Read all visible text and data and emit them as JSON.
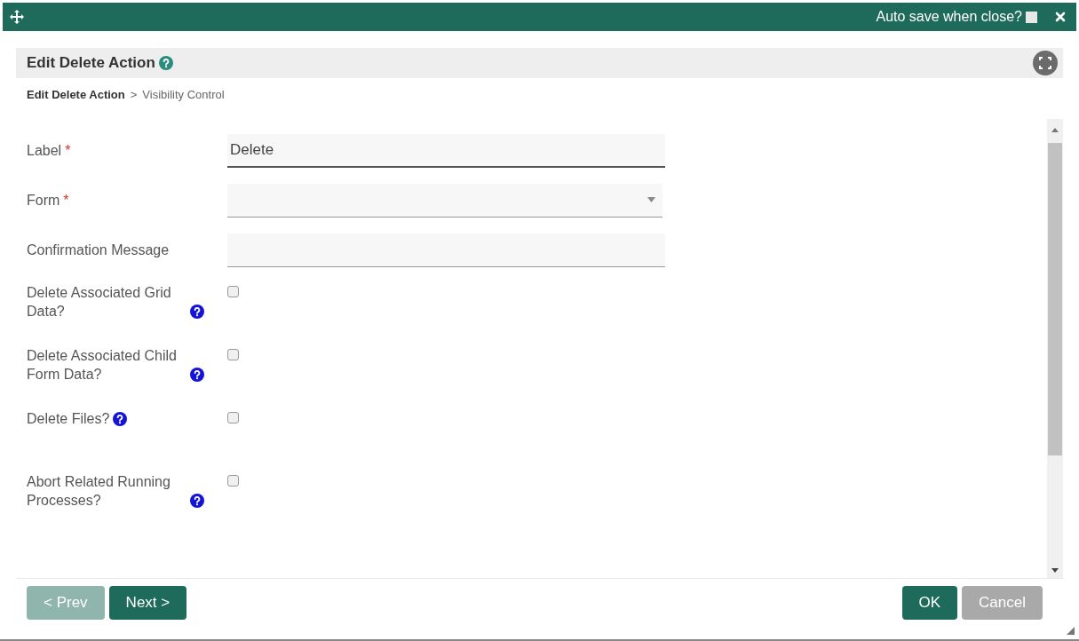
{
  "top_bar": {
    "autosave_label": "Auto save when close?",
    "autosave_checked": false
  },
  "header": {
    "title": "Edit Delete Action"
  },
  "breadcrumb": [
    {
      "label": "Edit Delete Action",
      "current": true
    },
    {
      "label": ">",
      "current": false
    },
    {
      "label": "Visibility Control",
      "current": false
    }
  ],
  "fields": [
    {
      "kind": "text",
      "label": "Label",
      "required": true,
      "value": "Delete",
      "focused": true
    },
    {
      "kind": "select",
      "label": "Form",
      "required": true
    },
    {
      "kind": "text",
      "label": "Confirmation Message",
      "required": false,
      "focused": false
    },
    {
      "kind": "checkbox",
      "label": "Delete Associated Grid Data?",
      "checked": false,
      "help": true
    },
    {
      "kind": "checkbox",
      "label": "Delete Associated Child Form Data?",
      "checked": false,
      "help": true
    },
    {
      "kind": "checkbox",
      "label": "Delete Files?",
      "checked": false,
      "help": true
    },
    {
      "kind": "checkbox",
      "label": "Abort Related Running Processes?",
      "checked": false,
      "help": true
    }
  ],
  "required_mark": "*",
  "nav_buttons": [
    {
      "label": "< Prev",
      "disabled": true
    },
    {
      "label": "Next >",
      "disabled": false
    }
  ],
  "action_buttons": [
    {
      "label": "OK",
      "disabled": false
    },
    {
      "label": "Cancel",
      "disabled": true
    }
  ]
}
